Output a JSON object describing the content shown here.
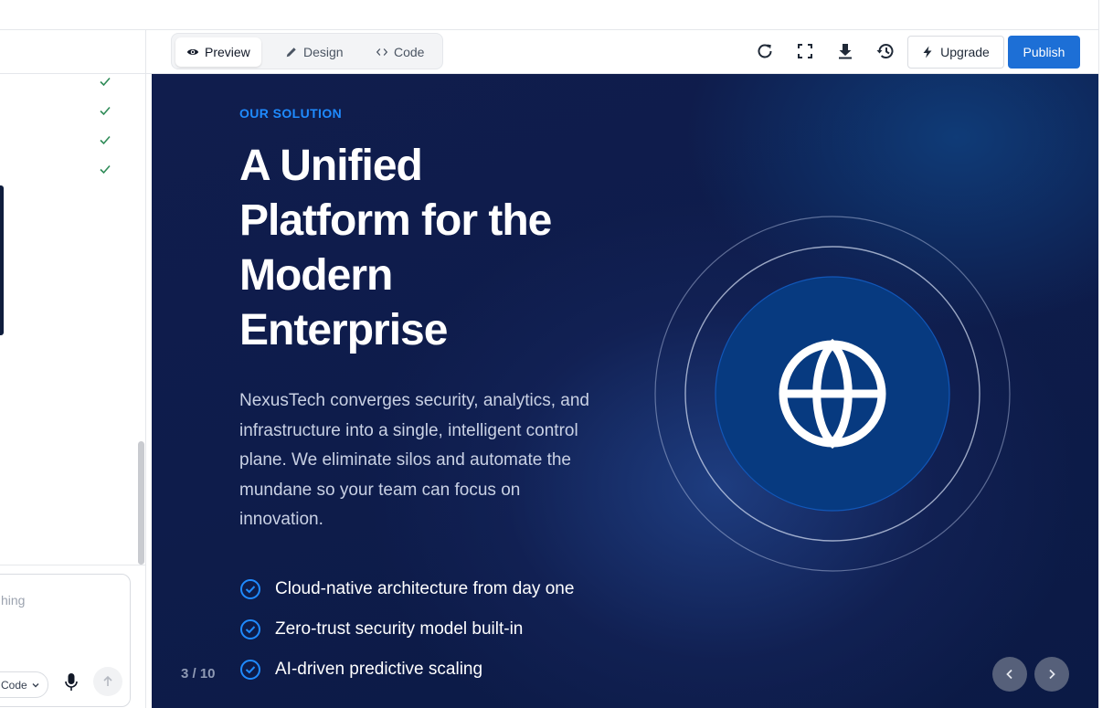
{
  "toolbar": {
    "tabs": [
      {
        "label": "Preview",
        "icon": "eye-icon",
        "active": true
      },
      {
        "label": "Design",
        "icon": "pencil-icon",
        "active": false
      },
      {
        "label": "Code",
        "icon": "code-icon",
        "active": false
      }
    ],
    "tools": [
      "refresh-icon",
      "fullscreen-icon",
      "download-icon",
      "history-icon"
    ],
    "upgrade_label": "Upgrade",
    "publish_label": "Publish",
    "accent": "#1d6fd6"
  },
  "sidebar": {
    "check_count": 4,
    "chat": {
      "placeholder": "hing",
      "mode_label": "Code"
    }
  },
  "slide": {
    "eyebrow": "OUR SOLUTION",
    "headline_lines": [
      "A Unified",
      "Platform for the",
      "Modern",
      "Enterprise"
    ],
    "body": "NexusTech converges security, analytics, and infrastructure into a single, intelligent control plane. We eliminate silos and automate the mundane so your team can focus on innovation.",
    "bullets": [
      "Cloud-native architecture from day one",
      "Zero-trust security model built-in",
      "AI-driven predictive scaling"
    ],
    "page_indicator": "3 / 10",
    "hero_icon": "globe-icon",
    "colors": {
      "eyebrow": "#1f8bff",
      "background": "#0e1c4b"
    }
  }
}
